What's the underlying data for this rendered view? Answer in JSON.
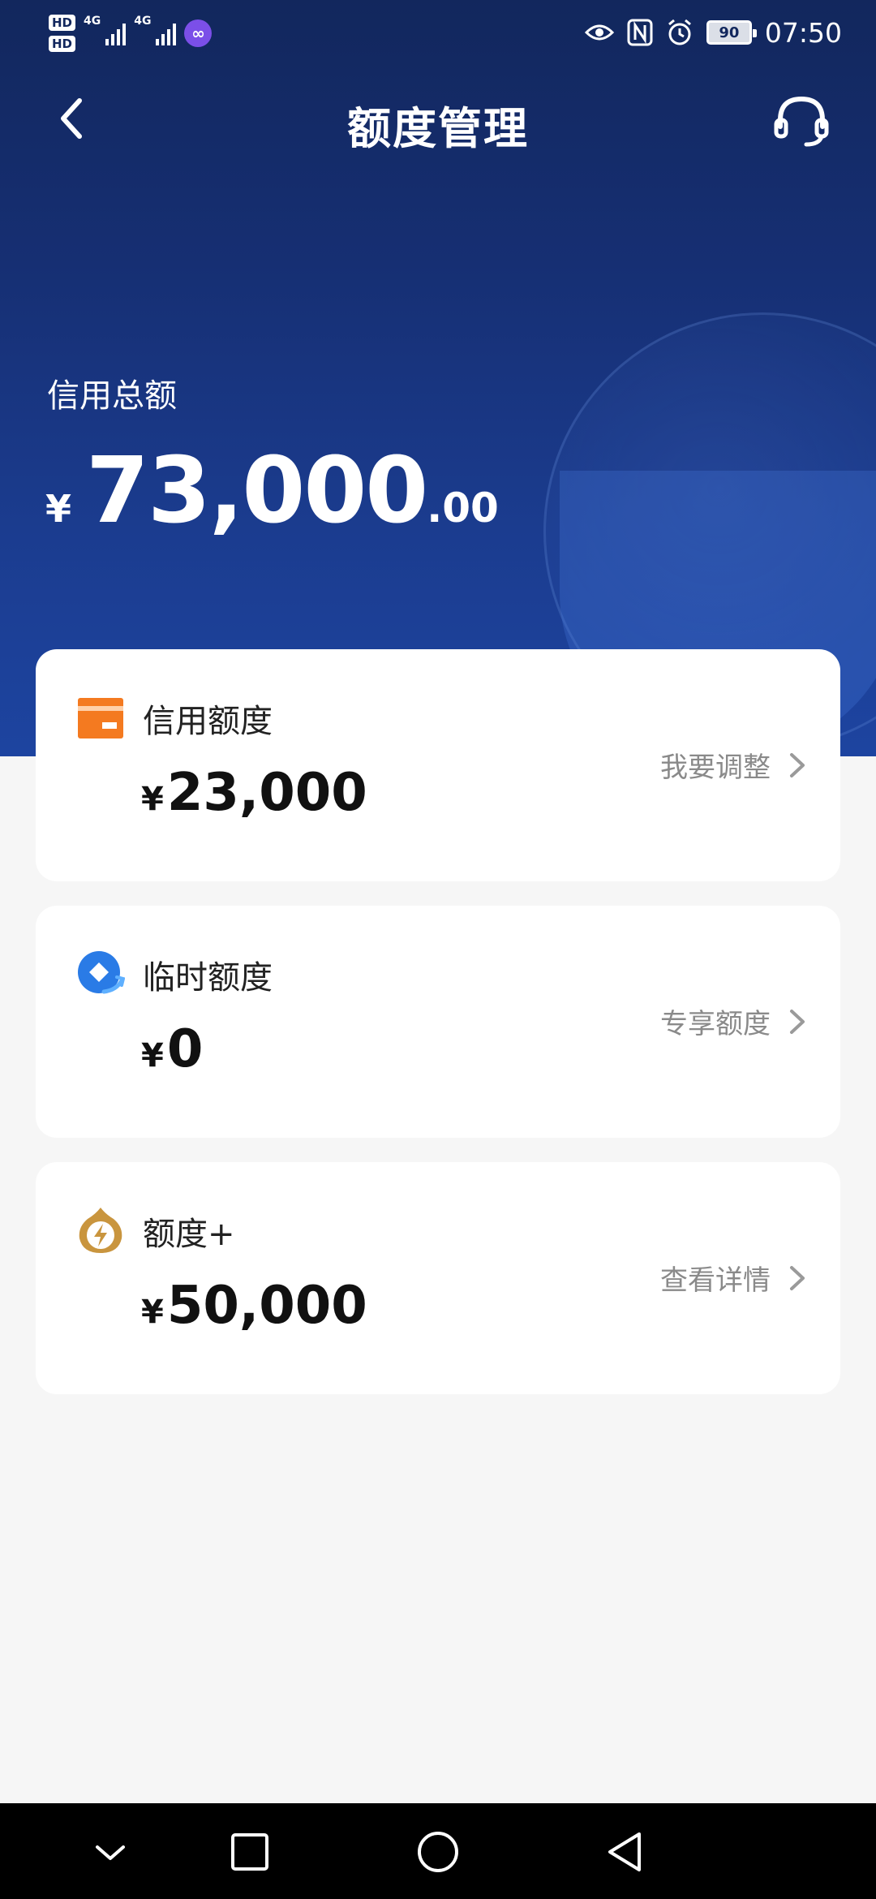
{
  "status_bar": {
    "hd1": "HD",
    "hd2": "HD",
    "net1": "4G",
    "net2": "4G",
    "battery": "90",
    "time": "07:50"
  },
  "header": {
    "title": "额度管理",
    "back_icon": "back-arrow-icon",
    "service_icon": "headset-icon"
  },
  "summary": {
    "label": "信用总额",
    "currency": "¥",
    "integer": "73,000",
    "decimal": ".00"
  },
  "cards": [
    {
      "title": "信用额度",
      "currency": "¥",
      "amount": "23,000",
      "action": "我要调整",
      "icon": "card-icon",
      "color": "#f47a20"
    },
    {
      "title": "临时额度",
      "currency": "¥",
      "amount": "0",
      "action": "专享额度",
      "icon": "temp-credit-icon",
      "color": "#2a7be6"
    },
    {
      "title": "额度+",
      "currency": "¥",
      "amount": "50,000",
      "action": "查看详情",
      "icon": "lightning-drop-icon",
      "color": "#c9953e"
    }
  ],
  "colors": {
    "hero_dark": "#12275d",
    "hero_light": "#1d44a0",
    "background": "#f6f6f6"
  }
}
